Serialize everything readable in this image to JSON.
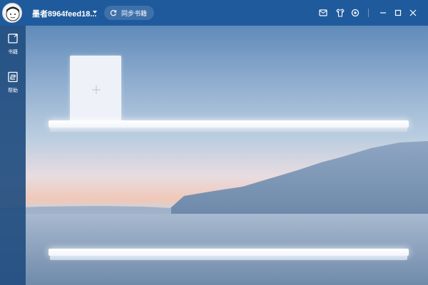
{
  "user": {
    "name": "墨者8964feed18..."
  },
  "toolbar": {
    "sync_label": "同步书籍"
  },
  "window_controls": [
    "mail-icon",
    "tshirt-icon",
    "settings-icon",
    "minimize-icon",
    "maximize-icon",
    "close-icon"
  ],
  "sidebar": {
    "items": [
      {
        "label": "书籍",
        "icon": "book-icon"
      },
      {
        "label": "帮助",
        "icon": "help-icon"
      }
    ]
  },
  "shelf": {
    "add_book_icon": "plus-icon"
  },
  "colors": {
    "titlebar": "#1f5a9c",
    "sidebar": "#224e80",
    "text": "#ffffff"
  }
}
